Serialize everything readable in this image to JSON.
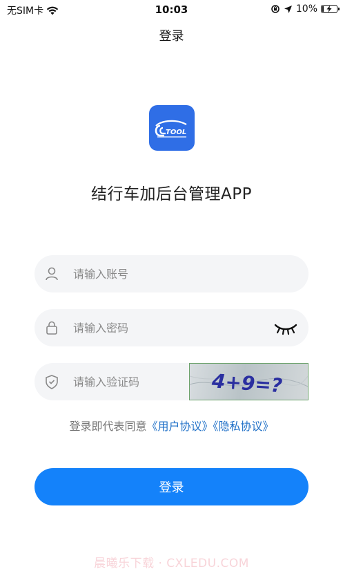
{
  "status_bar": {
    "carrier": "无SIM卡",
    "time": "10:03",
    "battery_percent": "10%",
    "battery_level": 0.1
  },
  "header": {
    "title": "登录"
  },
  "app": {
    "logo_text": "TOOL",
    "title": "结行车加后台管理APP"
  },
  "form": {
    "account_placeholder": "请输入账号",
    "password_placeholder": "请输入密码",
    "captcha_placeholder": "请输入验证码",
    "captcha_image_text": "4+9=?"
  },
  "agreement": {
    "prefix": "登录即代表同意",
    "user_agreement": "《用户协议》",
    "privacy_policy": "《隐私协议》"
  },
  "actions": {
    "login_label": "登录"
  },
  "watermark": "晨曦乐下载 · CXLEDU.COM",
  "colors": {
    "primary": "#1482fa",
    "logo_bg": "#2f6ee6",
    "link": "#1e6fc7",
    "field_bg": "#f4f5f7"
  }
}
